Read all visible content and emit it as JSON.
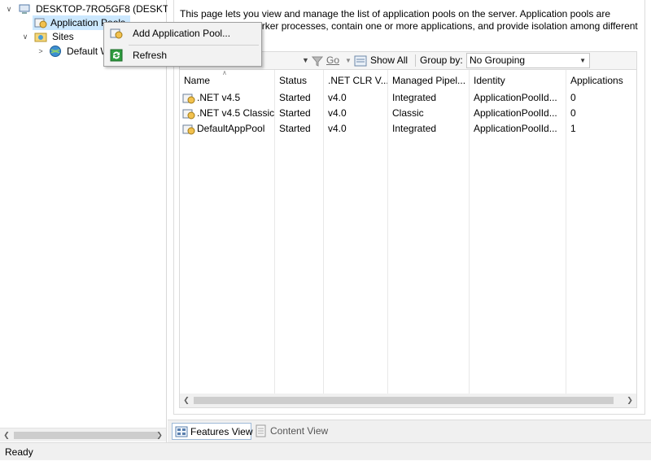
{
  "tree": {
    "server_label": "DESKTOP-7RO5GF8 (DESKTOP",
    "app_pools_label": "Application Pools",
    "sites_label": "Sites",
    "default_site_label": "Default W"
  },
  "context_menu": {
    "add_label": "Add Application Pool...",
    "refresh_label": "Refresh"
  },
  "description": "This page lets you view and manage the list of application pools on the server. Application pools are associated with worker processes, contain one or more applications, and provide isolation among different",
  "toolbar": {
    "go_label": "Go",
    "show_all_label": "Show All",
    "group_by_label": "Group by:",
    "group_value": "No Grouping"
  },
  "grid": {
    "columns": [
      "Name",
      "Status",
      ".NET CLR V...",
      "Managed Pipel...",
      "Identity",
      "Applications"
    ],
    "rows": [
      {
        "name": ".NET v4.5",
        "status": "Started",
        "clr": "v4.0",
        "pipeline": "Integrated",
        "identity": "ApplicationPoolId...",
        "apps": "0"
      },
      {
        "name": ".NET v4.5 Classic",
        "status": "Started",
        "clr": "v4.0",
        "pipeline": "Classic",
        "identity": "ApplicationPoolId...",
        "apps": "0"
      },
      {
        "name": "DefaultAppPool",
        "status": "Started",
        "clr": "v4.0",
        "pipeline": "Integrated",
        "identity": "ApplicationPoolId...",
        "apps": "1"
      }
    ]
  },
  "view_tabs": {
    "features": "Features View",
    "content": "Content View"
  },
  "status_bar": {
    "text": "Ready"
  }
}
